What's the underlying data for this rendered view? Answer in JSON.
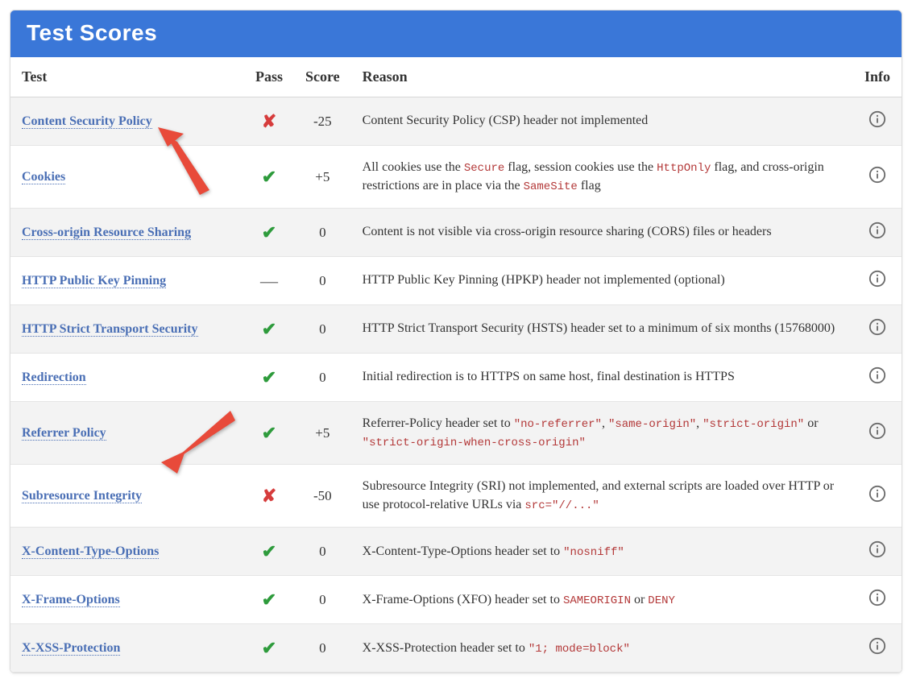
{
  "title": "Test Scores",
  "columns": {
    "test": "Test",
    "pass": "Pass",
    "score": "Score",
    "reason": "Reason",
    "info": "Info"
  },
  "rows": [
    {
      "test": "Content Security Policy",
      "status": "fail",
      "score": "-25",
      "reason": {
        "segments": [
          {
            "t": "Content Security Policy (CSP) header not implemented",
            "code": false
          }
        ]
      }
    },
    {
      "test": "Cookies",
      "status": "pass",
      "score": "+5",
      "reason": {
        "segments": [
          {
            "t": "All cookies use the ",
            "code": false
          },
          {
            "t": "Secure",
            "code": true
          },
          {
            "t": " flag, session cookies use the ",
            "code": false
          },
          {
            "t": "HttpOnly",
            "code": true
          },
          {
            "t": " flag, and cross-origin restrictions are in place via the ",
            "code": false
          },
          {
            "t": "SameSite",
            "code": true
          },
          {
            "t": " flag",
            "code": false
          }
        ]
      }
    },
    {
      "test": "Cross-origin Resource Sharing",
      "status": "pass",
      "score": "0",
      "reason": {
        "segments": [
          {
            "t": "Content is not visible via cross-origin resource sharing (CORS) files or headers",
            "code": false
          }
        ]
      }
    },
    {
      "test": "HTTP Public Key Pinning",
      "status": "neutral",
      "score": "0",
      "reason": {
        "segments": [
          {
            "t": "HTTP Public Key Pinning (HPKP) header not implemented (optional)",
            "code": false
          }
        ]
      }
    },
    {
      "test": "HTTP Strict Transport Security",
      "status": "pass",
      "score": "0",
      "reason": {
        "segments": [
          {
            "t": "HTTP Strict Transport Security (HSTS) header set to a minimum of six months (15768000)",
            "code": false
          }
        ]
      }
    },
    {
      "test": "Redirection",
      "status": "pass",
      "score": "0",
      "reason": {
        "segments": [
          {
            "t": "Initial redirection is to HTTPS on same host, final destination is HTTPS",
            "code": false
          }
        ]
      }
    },
    {
      "test": "Referrer Policy",
      "status": "pass",
      "score": "+5",
      "reason": {
        "segments": [
          {
            "t": "Referrer-Policy header set to ",
            "code": false
          },
          {
            "t": "\"no-referrer\"",
            "code": true
          },
          {
            "t": ", ",
            "code": false
          },
          {
            "t": "\"same-origin\"",
            "code": true
          },
          {
            "t": ", ",
            "code": false
          },
          {
            "t": "\"strict-origin\"",
            "code": true
          },
          {
            "t": " or ",
            "code": false
          },
          {
            "t": "\"strict-origin-when-cross-origin\"",
            "code": true
          }
        ]
      }
    },
    {
      "test": "Subresource Integrity",
      "status": "fail",
      "score": "-50",
      "reason": {
        "segments": [
          {
            "t": "Subresource Integrity (SRI) not implemented, and external scripts are loaded over HTTP or use protocol-relative URLs via ",
            "code": false
          },
          {
            "t": "src=\"//...\"",
            "code": true
          }
        ]
      }
    },
    {
      "test": "X-Content-Type-Options",
      "status": "pass",
      "score": "0",
      "reason": {
        "segments": [
          {
            "t": "X-Content-Type-Options header set to ",
            "code": false
          },
          {
            "t": "\"nosniff\"",
            "code": true
          }
        ]
      }
    },
    {
      "test": "X-Frame-Options",
      "status": "pass",
      "score": "0",
      "reason": {
        "segments": [
          {
            "t": "X-Frame-Options (XFO) header set to ",
            "code": false
          },
          {
            "t": "SAMEORIGIN",
            "code": true
          },
          {
            "t": " or ",
            "code": false
          },
          {
            "t": "DENY",
            "code": true
          }
        ]
      }
    },
    {
      "test": "X-XSS-Protection",
      "status": "pass",
      "score": "0",
      "reason": {
        "segments": [
          {
            "t": "X-XSS-Protection header set to ",
            "code": false
          },
          {
            "t": "\"1; mode=block\"",
            "code": true
          }
        ]
      }
    }
  ]
}
